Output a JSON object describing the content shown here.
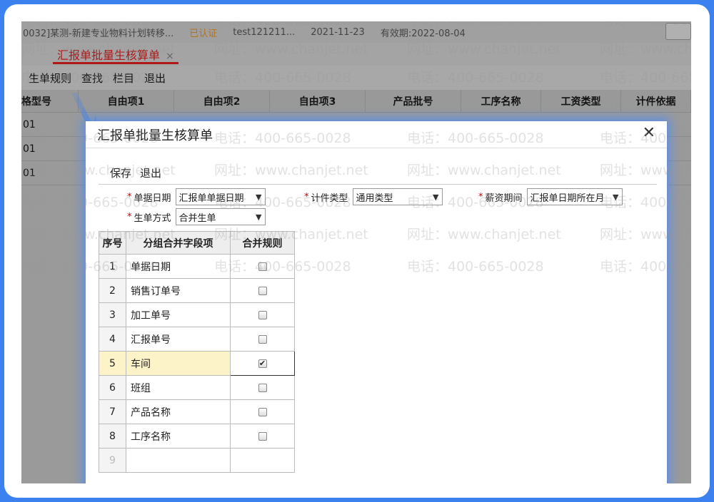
{
  "topbar": {
    "account": "0032]某测-新建专业物料计划转移...",
    "cert": "已认证",
    "user": "test121211...",
    "date": "2021-11-23",
    "valid": "有效期:2022-08-04"
  },
  "tabs": [
    {
      "label": "汇报单批量生核算单",
      "close": "×"
    }
  ],
  "menu": [
    "生单规则",
    "查找",
    "栏目",
    "退出"
  ],
  "grid": {
    "columns": [
      "格型号",
      "自由项1",
      "自由项2",
      "自由项3",
      "产品批号",
      "工序名称",
      "工资类型",
      "计件依据"
    ],
    "rows": [
      "01",
      "01",
      "01"
    ]
  },
  "dialog": {
    "title": "汇报单批量生核算单",
    "close": "✕",
    "toolbar": [
      "保存",
      "退出"
    ],
    "fields": {
      "bill_date": {
        "label": "单据日期",
        "value": "汇报单单据日期"
      },
      "piece_type": {
        "label": "计件类型",
        "value": "通用类型"
      },
      "salary_period": {
        "label": "薪资期间",
        "value": "汇报单日期所在月"
      },
      "gen_mode": {
        "label": "生单方式",
        "value": "合并生单"
      }
    },
    "table": {
      "headers": [
        "序号",
        "分组合并字段项",
        "合并规则"
      ],
      "rows": [
        {
          "no": "1",
          "field": "单据日期",
          "checked": false
        },
        {
          "no": "2",
          "field": "销售订单号",
          "checked": false
        },
        {
          "no": "3",
          "field": "加工单号",
          "checked": false
        },
        {
          "no": "4",
          "field": "汇报单号",
          "checked": false
        },
        {
          "no": "5",
          "field": "车间",
          "checked": true
        },
        {
          "no": "6",
          "field": "班组",
          "checked": false
        },
        {
          "no": "7",
          "field": "产品名称",
          "checked": false
        },
        {
          "no": "8",
          "field": "工序名称",
          "checked": false
        },
        {
          "no": "9",
          "field": "",
          "checked": false
        }
      ]
    }
  },
  "watermark": {
    "phone": "电话：400-665-0028",
    "site": "网址：www.chanjet.net"
  }
}
